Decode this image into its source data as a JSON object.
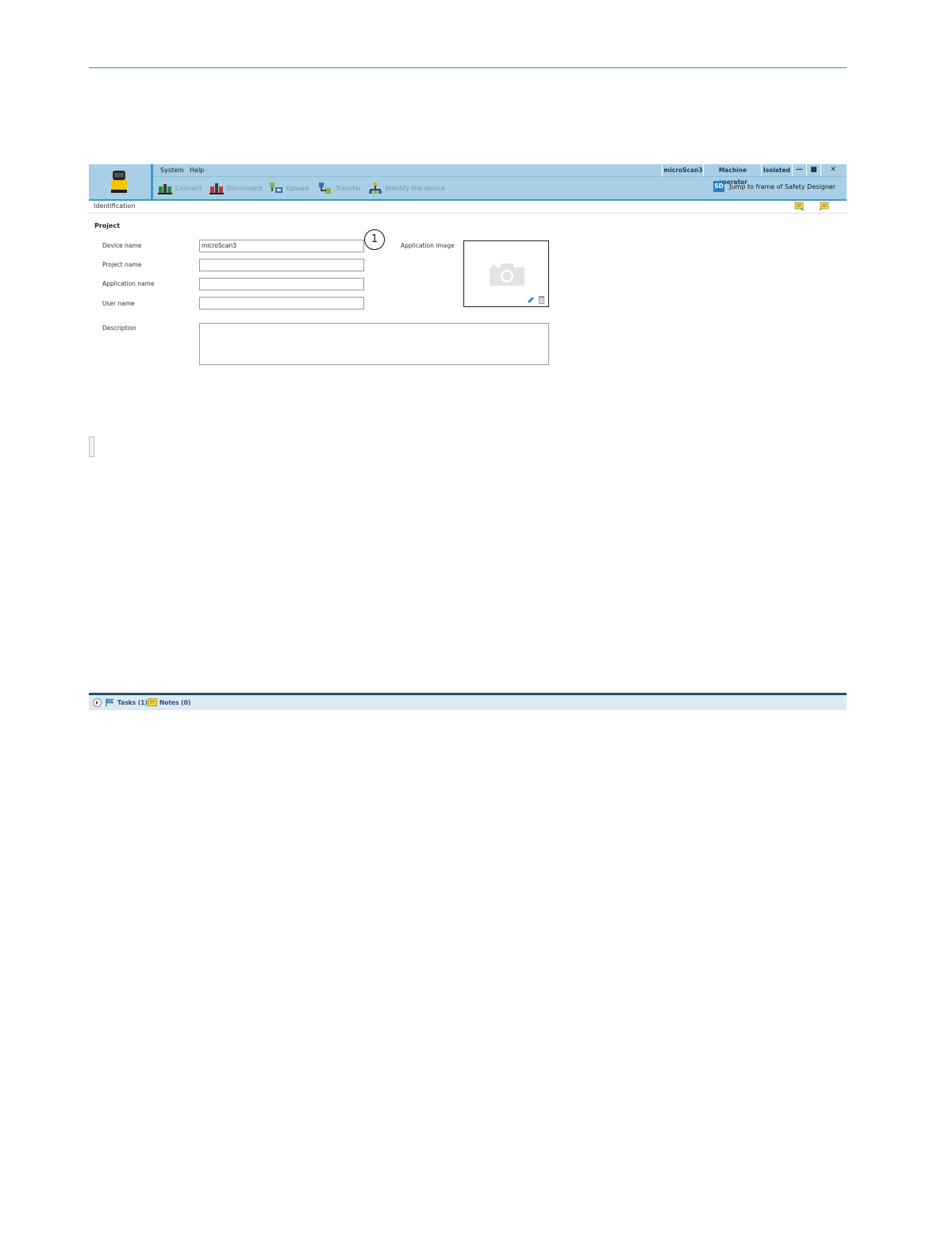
{
  "menu": {
    "system": "System",
    "help": "Help"
  },
  "status": {
    "device": "microScan3",
    "user_level": "Machine operator",
    "connection": "Isolated"
  },
  "window_controls": {
    "minimize": "—",
    "maximize": "■",
    "close": "✕"
  },
  "toolbar": {
    "connect": "Connect",
    "disconnect": "Disconnect",
    "upload": "Upload",
    "transfer": "Transfer",
    "identify": "Identify the device",
    "jump_badge": "SD",
    "jump": "Jump to frame of Safety Designer"
  },
  "tab": {
    "title": "Identification"
  },
  "form": {
    "section": "Project",
    "device_name_label": "Device name",
    "device_name_value": "microScan3",
    "project_name_label": "Project name",
    "project_name_value": "",
    "application_name_label": "Application name",
    "application_name_value": "",
    "user_name_label": "User name",
    "user_name_value": "",
    "description_label": "Description",
    "description_value": "",
    "application_image_label": "Application image"
  },
  "callout": "1",
  "bottom": {
    "tasks": "Tasks (1)",
    "notes": "Notes (0)"
  },
  "colors": {
    "header_bg": "#a8cfe6",
    "accent": "#3d96c6",
    "bottom_bar": "#dde9f1"
  }
}
